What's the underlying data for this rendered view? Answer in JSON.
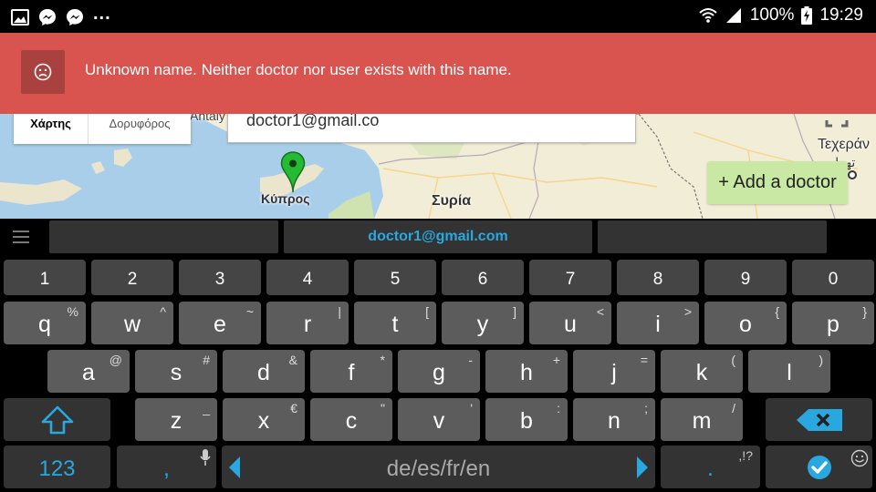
{
  "status_bar": {
    "battery": "100%",
    "time": "19:29",
    "more_indicator": "..."
  },
  "banner": {
    "message": "Unknown name. Neither doctor nor user exists with this name.",
    "color": "#d9534f"
  },
  "map": {
    "map_type_options": [
      "Χάρτης",
      "Δορυφόρος"
    ],
    "search_value": "doctor1@gmail.co",
    "labels": {
      "antalya": "Antaly",
      "cyprus": "Κύπρος",
      "syria": "Συρία",
      "tehran": "Τεχεράν",
      "tehran_native": "تهران"
    },
    "add_doctor_label": "+ Add a doctor"
  },
  "keyboard": {
    "suggestion": "doctor1@gmail.com",
    "number_row": [
      "1",
      "2",
      "3",
      "4",
      "5",
      "6",
      "7",
      "8",
      "9",
      "0"
    ],
    "row1": [
      {
        "k": "q",
        "a": "%"
      },
      {
        "k": "w",
        "a": "^"
      },
      {
        "k": "e",
        "a": "~"
      },
      {
        "k": "r",
        "a": "|"
      },
      {
        "k": "t",
        "a": "["
      },
      {
        "k": "y",
        "a": "]"
      },
      {
        "k": "u",
        "a": "<"
      },
      {
        "k": "i",
        "a": ">"
      },
      {
        "k": "o",
        "a": "{"
      },
      {
        "k": "p",
        "a": "}"
      }
    ],
    "row2": [
      {
        "k": "a",
        "a": "@"
      },
      {
        "k": "s",
        "a": "#"
      },
      {
        "k": "d",
        "a": "&"
      },
      {
        "k": "f",
        "a": "*"
      },
      {
        "k": "g",
        "a": "-"
      },
      {
        "k": "h",
        "a": "+"
      },
      {
        "k": "j",
        "a": "="
      },
      {
        "k": "k",
        "a": "("
      },
      {
        "k": "l",
        "a": ")"
      }
    ],
    "row3": [
      {
        "k": "z",
        "a": "_"
      },
      {
        "k": "x",
        "a": "€"
      },
      {
        "k": "c",
        "a": "\""
      },
      {
        "k": "v",
        "a": "'"
      },
      {
        "k": "b",
        "a": ":"
      },
      {
        "k": "n",
        "a": ";"
      },
      {
        "k": "m",
        "a": "/"
      }
    ],
    "symbols_label": "123",
    "comma_label": ",",
    "space_label": "de/es/fr/en",
    "period_label": ".",
    "period_alt": ",!?",
    "accent_color": "#29a8e0"
  }
}
